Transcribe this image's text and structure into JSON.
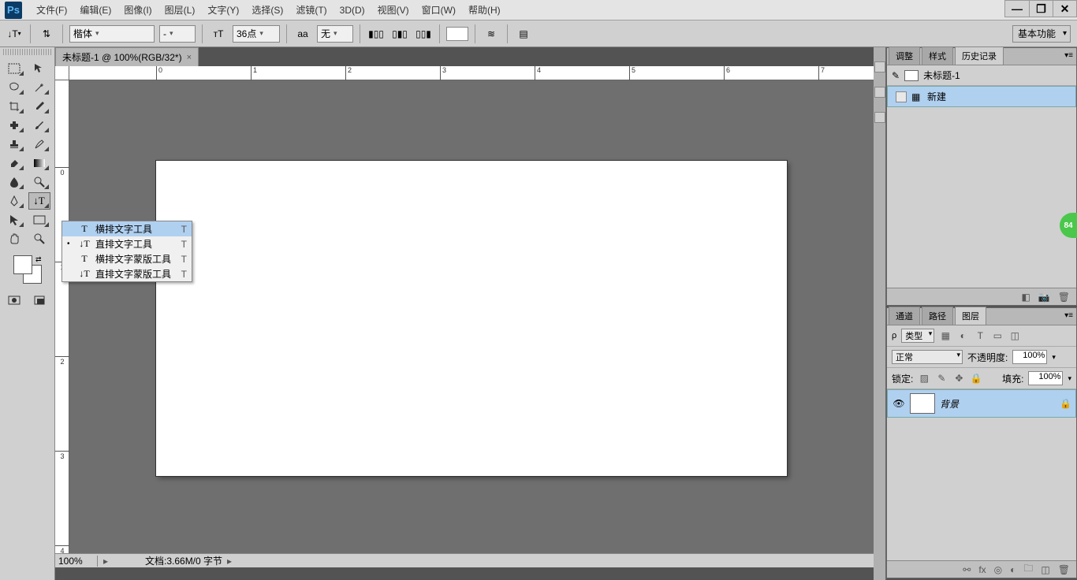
{
  "app": {
    "logo_text": "Ps"
  },
  "menubar": [
    "文件(F)",
    "编辑(E)",
    "图像(I)",
    "图层(L)",
    "文字(Y)",
    "选择(S)",
    "滤镜(T)",
    "3D(D)",
    "视图(V)",
    "窗口(W)",
    "帮助(H)"
  ],
  "window_controls": {
    "minimize": "—",
    "maximize": "❐",
    "close": "✕"
  },
  "options_bar": {
    "font_family": "楷体",
    "font_style": "-",
    "font_size": "36点",
    "aa_label": "aa",
    "aa_mode": "无",
    "workspace": "基本功能"
  },
  "document": {
    "tab_title": "未标题-1 @ 100%(RGB/32*)",
    "tab_close": "×"
  },
  "ruler": {
    "h_ticks": [
      "0",
      "1",
      "2",
      "3",
      "4",
      "5",
      "6",
      "7"
    ],
    "v_ticks": [
      "0",
      "1",
      "2",
      "3",
      "4"
    ]
  },
  "flyout_menu": [
    {
      "mark": "",
      "icon": "T",
      "label": "横排文字工具",
      "shortcut": "T",
      "hover": true
    },
    {
      "mark": "•",
      "icon": "↓T",
      "label": "直排文字工具",
      "shortcut": "T",
      "hover": false
    },
    {
      "mark": "",
      "icon": "T",
      "label": "横排文字蒙版工具",
      "shortcut": "T",
      "hover": false
    },
    {
      "mark": "",
      "icon": "↓T",
      "label": "直排文字蒙版工具",
      "shortcut": "T",
      "hover": false
    }
  ],
  "status": {
    "zoom": "100%",
    "doc_info": "文档:3.66M/0 字节"
  },
  "panels": {
    "top_tabs": [
      "调整",
      "样式",
      "历史记录"
    ],
    "history": {
      "doc_name": "未标题-1",
      "items": [
        "新建"
      ]
    },
    "bottom_tabs": [
      "通道",
      "路径",
      "图层"
    ],
    "layers": {
      "kind_label": "类型",
      "blend_mode": "正常",
      "opacity_label": "不透明度:",
      "opacity_value": "100%",
      "lock_label": "锁定:",
      "fill_label": "填充:",
      "fill_value": "100%",
      "layer_name": "背景"
    }
  },
  "badge": "84"
}
